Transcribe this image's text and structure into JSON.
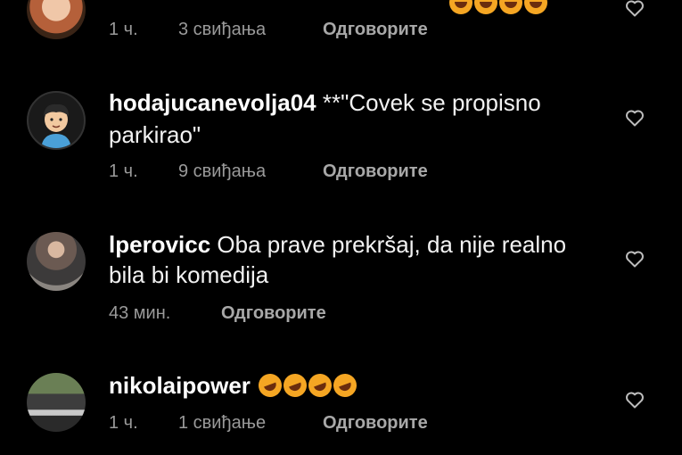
{
  "comments": [
    {
      "username": "",
      "text": "",
      "time": "1 ч.",
      "likes": "3 свиђања",
      "reply": "Одговорите",
      "avatar_icon": "avatar-woman-icon",
      "emoji_icon": "face-with-tears-of-joy-icon",
      "emoji_count": 4
    },
    {
      "username": "hodajucanevolja04",
      "text_line1": "**\"Covek se propisno",
      "text_line2": "parkirao\"",
      "time": "1 ч.",
      "likes": "9 свиђања",
      "reply": "Одговорите",
      "avatar_icon": "avatar-cartoon-boy-icon"
    },
    {
      "username": "lperovicc",
      "text_line1": "Oba prave prekršaj, da nije realno",
      "text_line2": "bila bi komedija",
      "time": "43 мин.",
      "reply": "Одговорите",
      "avatar_icon": "avatar-photo-icon"
    },
    {
      "username": "nikolaipower",
      "time": "1 ч.",
      "likes": "1 свиђање",
      "reply": "Одговорите",
      "avatar_icon": "avatar-photo-icon",
      "emoji_icon": "rolling-on-floor-laughing-icon",
      "emoji_count": 4
    }
  ],
  "colors": {
    "background": "#000000",
    "text": "#f2f2f2",
    "meta": "#9a9a9a",
    "emoji": "#f5a623"
  },
  "icons": {
    "like": "heart-outline-icon"
  }
}
